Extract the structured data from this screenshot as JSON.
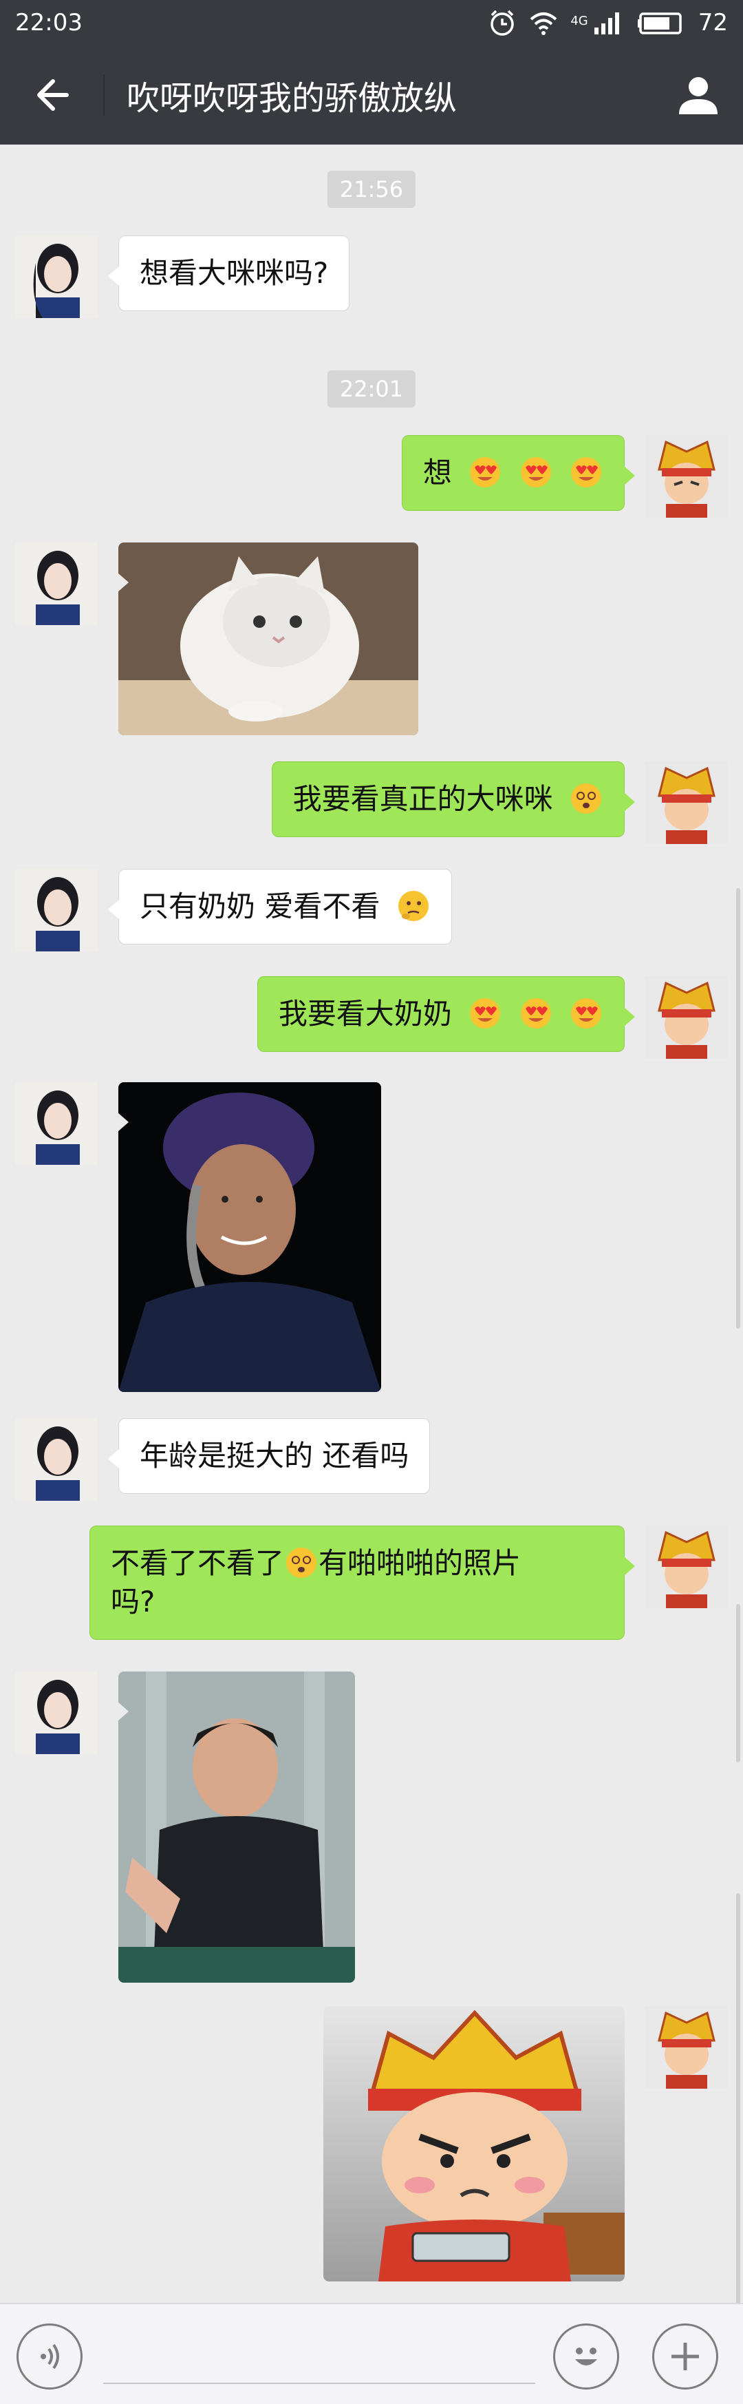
{
  "status_bar": {
    "time": "22:03",
    "network": "4G",
    "battery": "72"
  },
  "header": {
    "title": "吹呀吹呀我的骄傲放纵",
    "back_icon": "back-arrow-icon",
    "profile_icon": "person-icon"
  },
  "colors": {
    "header_bg": "#393a3f",
    "chat_bg": "#ebebeb",
    "outgoing_bubble": "#9fe658",
    "incoming_bubble": "#ffffff"
  },
  "messages": {
    "t1": "21:56",
    "m1": "想看大咪咪吗?",
    "t2": "22:01",
    "m2": "想",
    "m3_image": "kitten-photo",
    "m4": "我要看真正的大咪咪",
    "m5": "只有奶奶 爱看不看",
    "m6": "我要看大奶奶",
    "m7_image": "grandma-photo",
    "m8": "年龄是挺大的 还看吗",
    "m9_line1": "不看了不看了",
    "m9_line1b": "有啪啪啪的照片",
    "m9_line2": "吗?",
    "m10_image": "man-clapping-photo",
    "m11_image": "angry-cartoon-sticker"
  },
  "input_bar": {
    "placeholder": "",
    "voice_icon": "voice-icon",
    "emoji_icon": "emoji-icon",
    "plus_icon": "plus-icon"
  }
}
